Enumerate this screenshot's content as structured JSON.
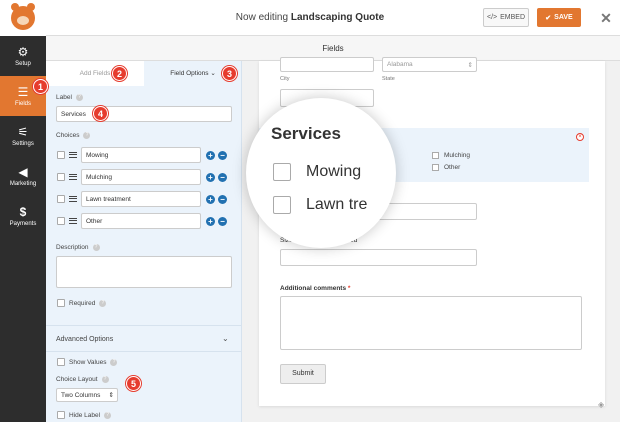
{
  "header": {
    "title_prefix": "Now editing",
    "title_form": "Landscaping Quote",
    "embed_label": "EMBED",
    "save_label": "SAVE",
    "close_glyph": "✕"
  },
  "nav": {
    "items": [
      {
        "label": "Setup",
        "icon": "gear-icon",
        "glyph": "⚙"
      },
      {
        "label": "Fields",
        "icon": "list-icon",
        "glyph": "☰"
      },
      {
        "label": "Settings",
        "icon": "sliders-icon",
        "glyph": "⚟"
      },
      {
        "label": "Marketing",
        "icon": "megaphone-icon",
        "glyph": "📢"
      },
      {
        "label": "Payments",
        "icon": "dollar-icon",
        "glyph": "$"
      }
    ]
  },
  "fields_bar": {
    "title": "Fields"
  },
  "panel": {
    "tab_add": "Add Fields",
    "tab_options": "Field Options",
    "label_label": "Label",
    "label_value": "Services",
    "choices_label": "Choices",
    "choices": [
      "Mowing",
      "Mulching",
      "Lawn treatment",
      "Other"
    ],
    "description_label": "Description",
    "required_label": "Required",
    "advanced_label": "Advanced Options",
    "show_values_label": "Show Values",
    "choice_layout_label": "Choice Layout",
    "choice_layout_value": "Two Columns",
    "hide_label_label": "Hide Label"
  },
  "badges": [
    "1",
    "2",
    "3",
    "4",
    "5"
  ],
  "preview": {
    "state_value": "Alabama",
    "city_label": "City",
    "state_label": "State",
    "services_options_right": [
      "Mulching",
      "Other"
    ],
    "mulch_label": "Size of area to be mulched",
    "comments_label": "Additional comments",
    "required_star": "*",
    "submit_label": "Submit"
  },
  "magnifier": {
    "title": "Services",
    "options": [
      "Mowing",
      "Lawn tre"
    ]
  },
  "colors": {
    "accent": "#e27730",
    "badge": "#e63c2e",
    "nav_bg": "#2d2d2d",
    "panel_bg": "#ebf3fb",
    "blue": "#2271b1"
  }
}
